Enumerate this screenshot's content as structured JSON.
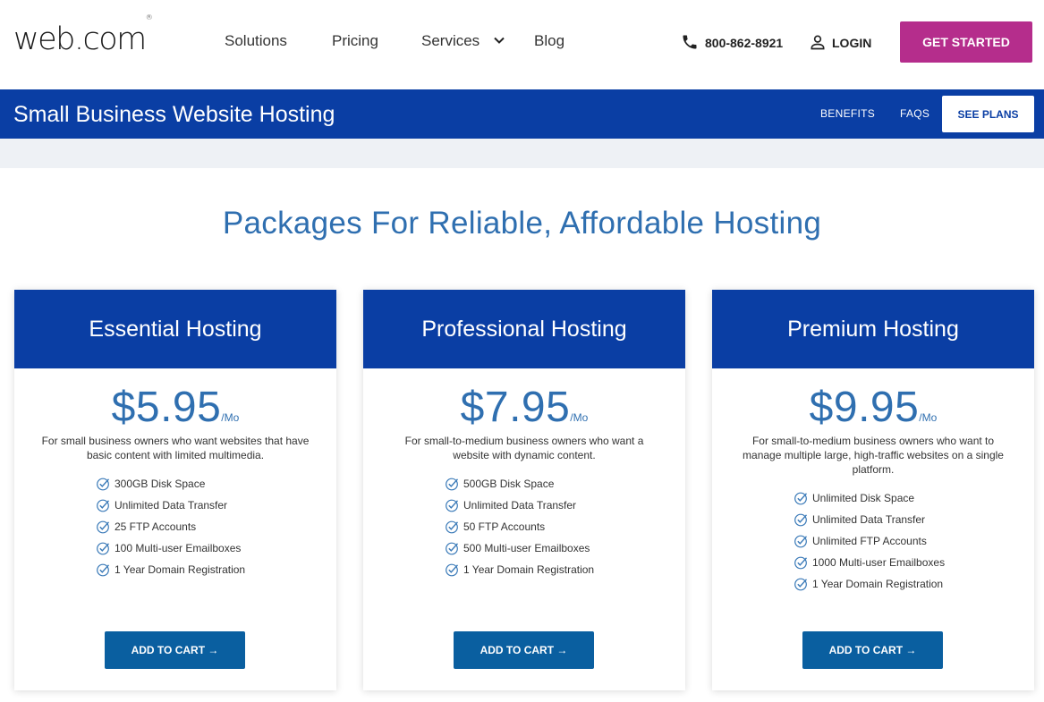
{
  "header": {
    "logo": "web.com",
    "logo_mark": "®",
    "nav": [
      "Solutions",
      "Pricing",
      "Services",
      "Blog"
    ],
    "phone": "800-862-8921",
    "login": "LOGIN",
    "cta": "GET STARTED"
  },
  "subbar": {
    "title": "Small Business Website Hosting",
    "links": [
      "BENEFITS",
      "FAQS"
    ],
    "cta": "SEE PLANS"
  },
  "section_title": "Packages For Reliable, Affordable Hosting",
  "plans": [
    {
      "name": "Essential Hosting",
      "price": "$5.95",
      "period": "/Mo",
      "description": "For small business owners who want websites that have basic content with limited multimedia.",
      "features": [
        "300GB Disk Space",
        "Unlimited Data Transfer",
        "25 FTP Accounts",
        "100 Multi-user Emailboxes",
        "1 Year Domain Registration"
      ],
      "cta": "ADD TO CART"
    },
    {
      "name": "Professional Hosting",
      "price": "$7.95",
      "period": "/Mo",
      "description": "For small-to-medium business owners who want a website with dynamic content.",
      "features": [
        "500GB Disk Space",
        "Unlimited Data Transfer",
        "50 FTP Accounts",
        "500 Multi-user Emailboxes",
        "1 Year Domain Registration"
      ],
      "cta": "ADD TO CART"
    },
    {
      "name": "Premium Hosting",
      "price": "$9.95",
      "period": "/Mo",
      "description": "For small-to-medium business owners who want to manage multiple large, high-traffic websites on a single platform.",
      "features": [
        "Unlimited Disk Space",
        "Unlimited Data Transfer",
        "Unlimited FTP Accounts",
        "1000 Multi-user Emailboxes",
        "1 Year Domain Registration"
      ],
      "cta": "ADD TO CART"
    }
  ],
  "colors": {
    "brand_blue": "#0a3ea4",
    "accent_magenta": "#b52d8c",
    "price_blue": "#2f6fb0",
    "cart_button": "#0a5fa0"
  },
  "icons": [
    "phone-icon",
    "user-icon",
    "chevron-down-icon",
    "check-circle-icon",
    "arrow-right-icon"
  ]
}
